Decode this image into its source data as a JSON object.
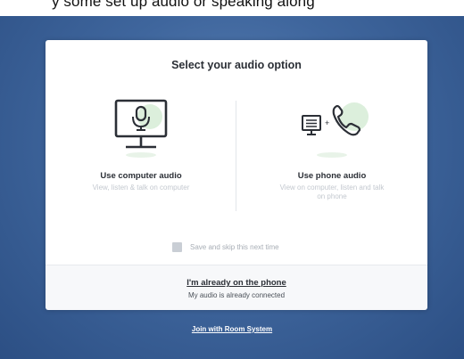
{
  "top_text": "y some set up audio or speaking along",
  "dialog": {
    "title": "Select your audio option",
    "computer": {
      "label": "Use computer audio",
      "description": "View, listen & talk on computer",
      "icons": [
        "monitor-icon",
        "microphone-icon"
      ]
    },
    "phone": {
      "label": "Use phone audio",
      "description": "View on computer, listen and talk on phone",
      "icons": [
        "computer-small-icon",
        "phone-handset-icon"
      ]
    },
    "skip_label": "Save and skip this next time",
    "skip_checked": false,
    "already_link": "I'm already on the phone",
    "already_sub": "My audio is already connected"
  },
  "room_system_link": "Join with Room System",
  "colors": {
    "accent_green": "#dcefdc",
    "text_dark": "#2b2f36",
    "bg_blue": "#3f669d"
  }
}
